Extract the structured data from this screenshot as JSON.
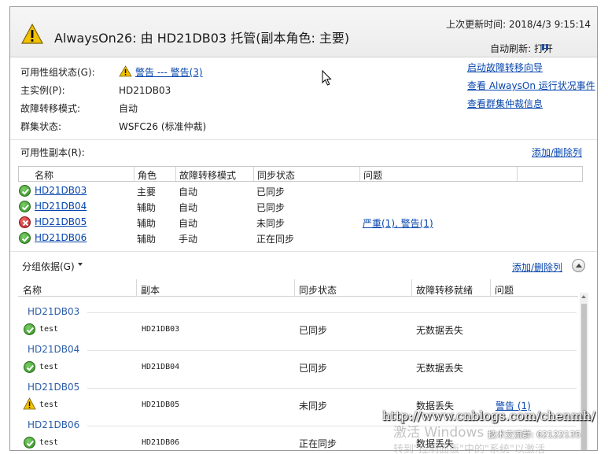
{
  "header": {
    "title": "AlwaysOn26: 由 HD21DB03 托管(副本角色: 主要)",
    "last_updated": "上次更新时间: 2018/4/3 9:15:14",
    "auto_refresh": "自动刷新: 打开",
    "status_icon": "warning-icon"
  },
  "summary": {
    "availability_state_label": "可用性组状态(G):",
    "availability_state_value": "警告 --- 警告(3)",
    "primary_instance_label": "主实例(P):",
    "primary_instance_value": "HD21DB03",
    "failover_mode_label": "故障转移模式:",
    "failover_mode_value": "自动",
    "cluster_state_label": "群集状态:",
    "cluster_state_value": "WSFC26 (标准仲裁)"
  },
  "links": {
    "start_failover_wizard": "启动故障转移向导",
    "view_alwayson_events": "查看 AlwaysOn 运行状况事件",
    "view_cluster_quorum": "查看群集仲裁信息"
  },
  "replicas": {
    "section_label": "可用性副本(R):",
    "add_remove_columns": "添加/删除列",
    "columns": [
      "名称",
      "角色",
      "故障转移模式",
      "同步状态",
      "问题"
    ],
    "rows": [
      {
        "status": "ok",
        "name": "HD21DB03",
        "role": "主要",
        "failover": "自动",
        "sync": "已同步",
        "issues": ""
      },
      {
        "status": "ok",
        "name": "HD21DB04",
        "role": "辅助",
        "failover": "自动",
        "sync": "已同步",
        "issues": ""
      },
      {
        "status": "error",
        "name": "HD21DB05",
        "role": "辅助",
        "failover": "自动",
        "sync": "未同步",
        "issues": "严重(1), 警告(1)"
      },
      {
        "status": "ok",
        "name": "HD21DB06",
        "role": "辅助",
        "failover": "手动",
        "sync": "正在同步",
        "issues": ""
      }
    ]
  },
  "databases": {
    "group_by_label": "分组依据(G)",
    "add_remove_columns": "添加/删除列",
    "columns": [
      "名称",
      "副本",
      "同步状态",
      "故障转移就绪",
      "问题"
    ],
    "groups": [
      {
        "group": "HD21DB03",
        "status": "ok",
        "name": "test",
        "replica": "HD21DB03",
        "sync": "已同步",
        "failover_ready": "无数据丢失",
        "issues": ""
      },
      {
        "group": "HD21DB04",
        "status": "ok",
        "name": "test",
        "replica": "HD21DB04",
        "sync": "已同步",
        "failover_ready": "无数据丢失",
        "issues": ""
      },
      {
        "group": "HD21DB05",
        "status": "warning",
        "name": "test",
        "replica": "HD21DB05",
        "sync": "未同步",
        "failover_ready": "数据丢失",
        "issues": "警告 (1)"
      },
      {
        "group": "HD21DB06",
        "status": "ok",
        "name": "test",
        "replica": "HD21DB06",
        "sync": "正在同步",
        "failover_ready": "数据丢失",
        "issues": ""
      }
    ]
  },
  "watermarks": {
    "url": "http://www.cnblogs.com/chenmh/",
    "windows": "激活 Windows",
    "qq": "技术交流群: 62122135",
    "bottom": "转到\"控制面板\"中的\"系统\"以激活"
  },
  "colors": {
    "link": "#0645ad",
    "group_name": "#2b5da8",
    "ok": "#2f8a1e",
    "error": "#b71c1c",
    "warning": "#f2c200"
  }
}
